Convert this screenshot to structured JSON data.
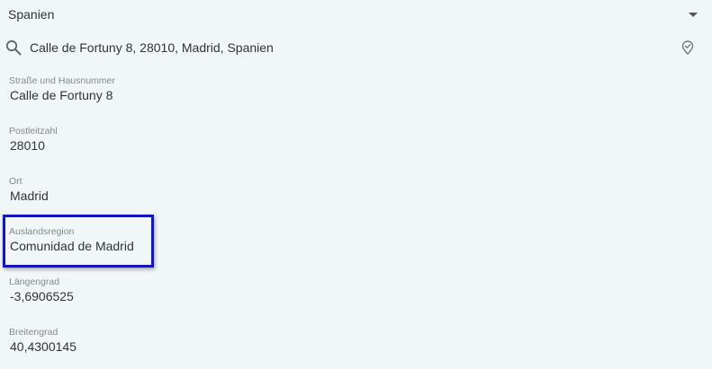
{
  "country": {
    "value": "Spanien"
  },
  "search": {
    "value": "Calle de Fortuny 8, 28010, Madrid, Spanien"
  },
  "fields": [
    {
      "label": "Straße und Hausnummer",
      "value": "Calle de Fortuny 8"
    },
    {
      "label": "Postleitzahl",
      "value": "28010"
    },
    {
      "label": "Ort",
      "value": "Madrid"
    },
    {
      "label": "Auslandsregion",
      "value": "Comunidad de Madrid"
    },
    {
      "label": "Längengrad",
      "value": "-3,6906525"
    },
    {
      "label": "Breitengrad",
      "value": "40,4300145"
    }
  ],
  "icons": {
    "search": "search-icon",
    "verify": "location-check-icon",
    "dropdown": "chevron-down-icon"
  },
  "colors": {
    "background": "#f1f6f9",
    "highlight": "#1010e0"
  }
}
